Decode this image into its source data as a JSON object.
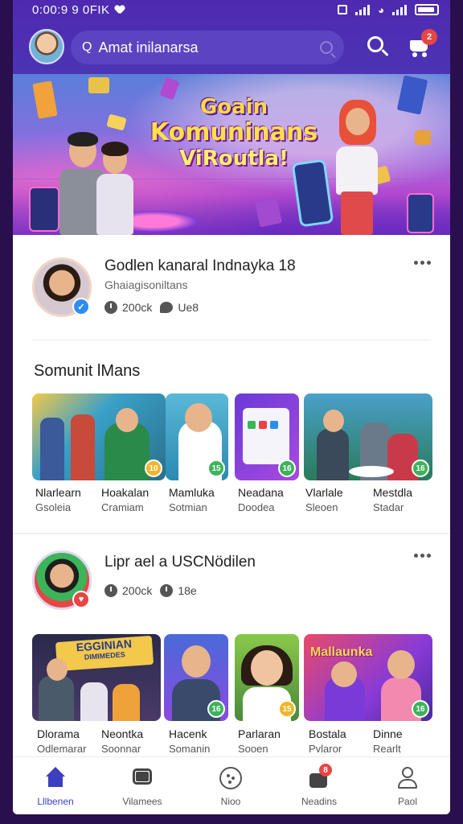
{
  "status_bar": {
    "time": "0:00:9 9 0FIK"
  },
  "header": {
    "search_placeholder": "Amat inilanarsa",
    "cart_badge": "2"
  },
  "banner": {
    "line1": "Goain",
    "line2": "Komuninans",
    "line3": "ViRoutla!"
  },
  "card1": {
    "title": "Godlen kanaral Indnayka 18",
    "subtitle": "Ghaiagisoniltans",
    "views": "200ck",
    "comments": "Ue8",
    "section_title": "Somunit lMans",
    "items": [
      {
        "name": "Nlarlearn",
        "sub": "Gsoleia",
        "badge": "10"
      },
      {
        "name": "Hoakalan",
        "sub": "Cramiam",
        "badge": ""
      },
      {
        "name": "Mamluka",
        "sub": "Sotmian",
        "badge": "15"
      },
      {
        "name": "Neadana",
        "sub": "Doodea",
        "badge": "16"
      },
      {
        "name": "Vlarlale",
        "sub": "Sleoen",
        "badge": ""
      },
      {
        "name": "Mestdla",
        "sub": "Stadar",
        "badge": "16"
      }
    ]
  },
  "card2": {
    "title": "Lipr ael a  USCNödilen",
    "views": "200ck",
    "comments": "18e",
    "items": [
      {
        "name": "Dlorama",
        "sub": "Odlemarar",
        "badge": ""
      },
      {
        "name": "Neontka",
        "sub": "Soonnar",
        "badge": ""
      },
      {
        "name": "Hacenk",
        "sub": "Somanin",
        "badge": "16"
      },
      {
        "name": "Parlaran",
        "sub": "Sooen",
        "badge": "15"
      },
      {
        "name": "Bostala",
        "sub": "Pvlaror",
        "badge": ""
      },
      {
        "name": "Dinne",
        "sub": "Rearlt",
        "badge": "16"
      }
    ],
    "thumb1_text_top": "EGGINIAN",
    "thumb1_text_bottom": "DIMIMEDES",
    "thumb4_text": "Mallaunka"
  },
  "bottom_nav": {
    "items": [
      {
        "label": "Lllbenen",
        "icon": "home-icon"
      },
      {
        "label": "Vilamees",
        "icon": "chat-icon"
      },
      {
        "label": "Nioo",
        "icon": "dots-circle-icon"
      },
      {
        "label": "Neadins",
        "icon": "notification-icon",
        "badge": "8"
      },
      {
        "label": "Paol",
        "icon": "profile-icon"
      }
    ]
  },
  "colors": {
    "header_bg": "#4e2ab0",
    "accent": "#3b3fc0",
    "badge_red": "#e84545",
    "badge_green": "#3db35a",
    "badge_yellow": "#f0b52a",
    "verify_blue": "#2e8df0"
  }
}
